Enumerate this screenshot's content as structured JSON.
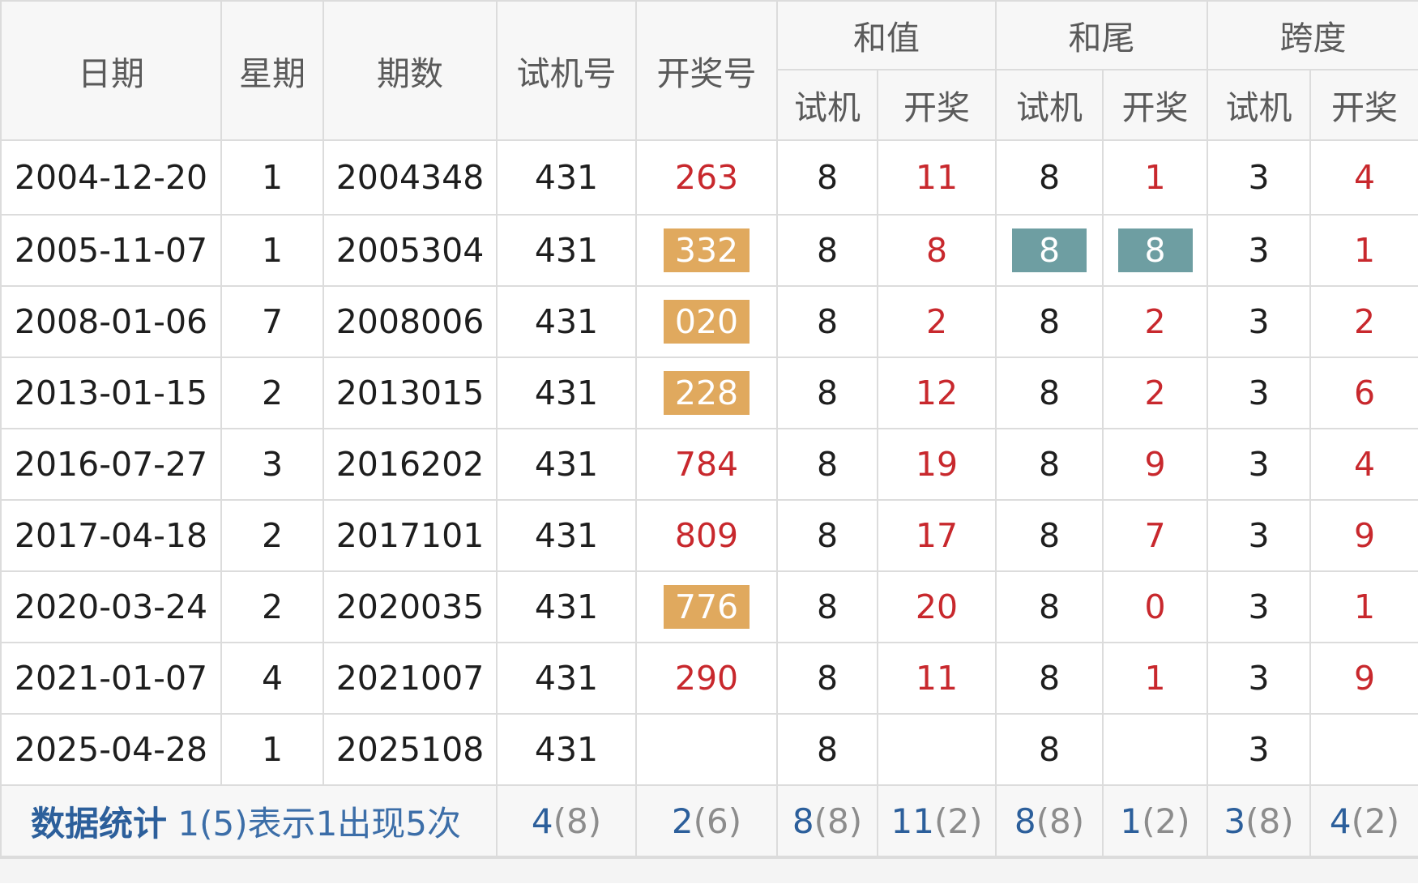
{
  "header": {
    "date": "日期",
    "weekday": "星期",
    "issue": "期数",
    "trial_number": "试机号",
    "draw_number": "开奖号",
    "sum_group": "和值",
    "tail_group": "和尾",
    "span_group": "跨度",
    "trial": "试机",
    "draw": "开奖"
  },
  "rows": [
    {
      "date": "2004-12-20",
      "weekday": "1",
      "issue": "2004348",
      "trial": "431",
      "draw": "263",
      "sum_trial": "8",
      "sum_draw": "11",
      "tail_trial": "8",
      "tail_draw": "1",
      "span_trial": "3",
      "span_draw": "4"
    },
    {
      "date": "2005-11-07",
      "weekday": "1",
      "issue": "2005304",
      "trial": "431",
      "draw": "332",
      "sum_trial": "8",
      "sum_draw": "8",
      "tail_trial": "8",
      "tail_draw": "8",
      "span_trial": "3",
      "span_draw": "1"
    },
    {
      "date": "2008-01-06",
      "weekday": "7",
      "issue": "2008006",
      "trial": "431",
      "draw": "020",
      "sum_trial": "8",
      "sum_draw": "2",
      "tail_trial": "8",
      "tail_draw": "2",
      "span_trial": "3",
      "span_draw": "2"
    },
    {
      "date": "2013-01-15",
      "weekday": "2",
      "issue": "2013015",
      "trial": "431",
      "draw": "228",
      "sum_trial": "8",
      "sum_draw": "12",
      "tail_trial": "8",
      "tail_draw": "2",
      "span_trial": "3",
      "span_draw": "6"
    },
    {
      "date": "2016-07-27",
      "weekday": "3",
      "issue": "2016202",
      "trial": "431",
      "draw": "784",
      "sum_trial": "8",
      "sum_draw": "19",
      "tail_trial": "8",
      "tail_draw": "9",
      "span_trial": "3",
      "span_draw": "4"
    },
    {
      "date": "2017-04-18",
      "weekday": "2",
      "issue": "2017101",
      "trial": "431",
      "draw": "809",
      "sum_trial": "8",
      "sum_draw": "17",
      "tail_trial": "8",
      "tail_draw": "7",
      "span_trial": "3",
      "span_draw": "9"
    },
    {
      "date": "2020-03-24",
      "weekday": "2",
      "issue": "2020035",
      "trial": "431",
      "draw": "776",
      "sum_trial": "8",
      "sum_draw": "20",
      "tail_trial": "8",
      "tail_draw": "0",
      "span_trial": "3",
      "span_draw": "1"
    },
    {
      "date": "2021-01-07",
      "weekday": "4",
      "issue": "2021007",
      "trial": "431",
      "draw": "290",
      "sum_trial": "8",
      "sum_draw": "11",
      "tail_trial": "8",
      "tail_draw": "1",
      "span_trial": "3",
      "span_draw": "9"
    },
    {
      "date": "2025-04-28",
      "weekday": "1",
      "issue": "2025108",
      "trial": "431",
      "draw": "",
      "sum_trial": "8",
      "sum_draw": "",
      "tail_trial": "8",
      "tail_draw": "",
      "span_trial": "3",
      "span_draw": ""
    }
  ],
  "stats": {
    "label": "数据统计",
    "description": "1(5)表示1出现5次",
    "trial": {
      "value": "4",
      "count": "(8)"
    },
    "draw": {
      "value": "2",
      "count": "(6)"
    },
    "sum_trial": {
      "value": "8",
      "count": "(8)"
    },
    "sum_draw": {
      "value": "11",
      "count": "(2)"
    },
    "tail_trial": {
      "value": "8",
      "count": "(8)"
    },
    "tail_draw": {
      "value": "1",
      "count": "(2)"
    },
    "span_trial": {
      "value": "3",
      "count": "(8)"
    },
    "span_draw": {
      "value": "4",
      "count": "(2)"
    }
  },
  "colors": {
    "draw_red": "#c8282d",
    "group_orange": "#e0a95e",
    "tail_teal": "#6e9ea2",
    "stat_blue": "#2c5f9b"
  }
}
